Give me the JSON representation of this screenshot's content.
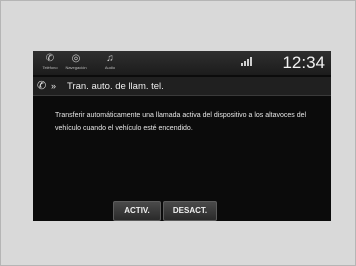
{
  "status_bar": {
    "items": [
      {
        "icon": "phone-icon",
        "label": "Teléfono"
      },
      {
        "icon": "navigation-icon",
        "label": "Navegación"
      },
      {
        "icon": "audio-icon",
        "label": "Audio"
      }
    ],
    "clock": "12:34"
  },
  "header": {
    "title": "Tran. auto. de llam. tel.",
    "icon": "phone-icon",
    "arrow": "»"
  },
  "description": "Transferir automáticamente una llamada activa del dispositivo a los altavoces del vehículo cuando el vehículo esté encendido.",
  "buttons": {
    "on_label": "ACTIV.",
    "off_label": "DESACT."
  }
}
